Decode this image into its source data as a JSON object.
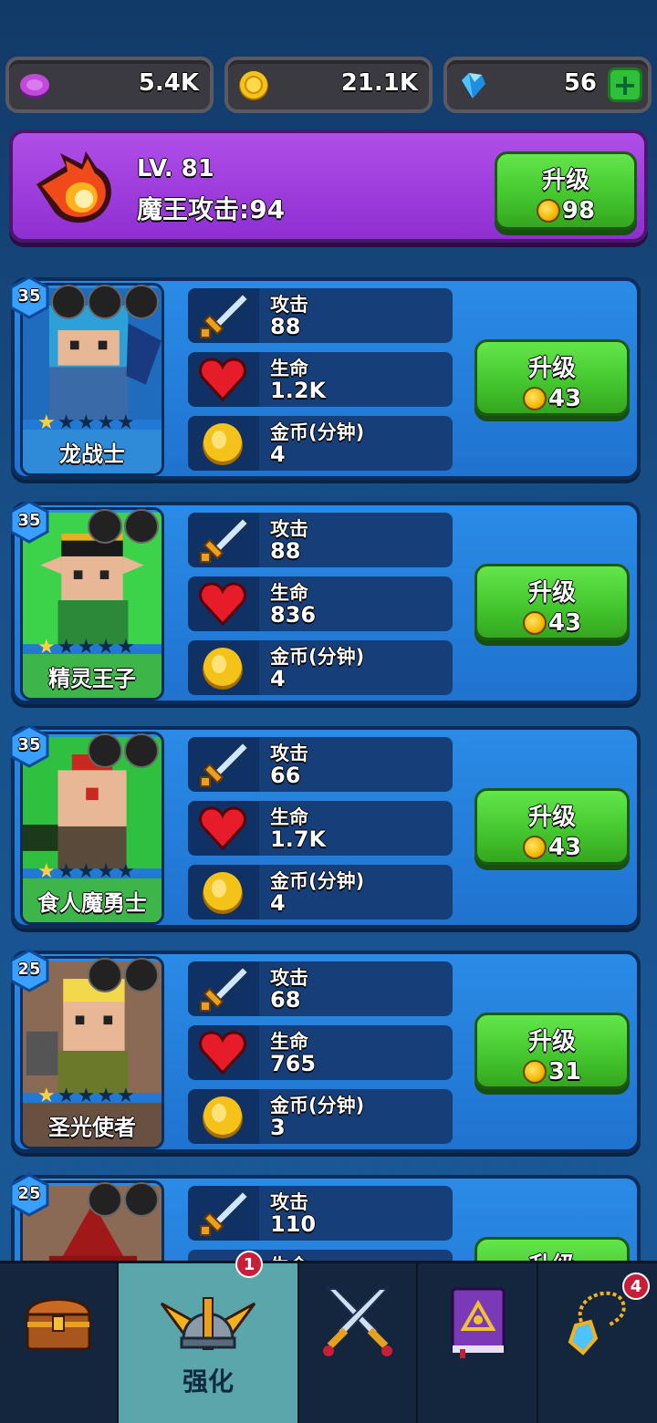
{
  "currencies": {
    "purple": {
      "value": "5.4K",
      "icon": "purple-gem-icon"
    },
    "gold": {
      "value": "21.1K",
      "icon": "gold-coin-icon"
    },
    "diamond": {
      "value": "56",
      "icon": "diamond-icon",
      "plus": "+"
    }
  },
  "boss": {
    "level": "LV. 81",
    "attack": "魔王攻击:94",
    "upgrade_label": "升级",
    "upgrade_cost": "98"
  },
  "stat_labels": {
    "attack": "攻击",
    "life": "生命",
    "gold": "金币(分钟)"
  },
  "heroes": [
    {
      "name": "龙战士",
      "level": "35",
      "stars": 1,
      "attack": "88",
      "life": "1.2K",
      "gold": "4",
      "upgrade_label": "升级",
      "cost": "43",
      "name_bg": "#2f8bd8",
      "art": "#2a78c8"
    },
    {
      "name": "精灵王子",
      "level": "35",
      "stars": 1,
      "attack": "88",
      "life": "836",
      "gold": "4",
      "upgrade_label": "升级",
      "cost": "43",
      "name_bg": "#3db548",
      "art": "#34c43e"
    },
    {
      "name": "食人魔勇士",
      "level": "35",
      "stars": 1,
      "attack": "66",
      "life": "1.7K",
      "gold": "4",
      "upgrade_label": "升级",
      "cost": "43",
      "name_bg": "#3db548",
      "art": "#2fc040"
    },
    {
      "name": "圣光使者",
      "level": "25",
      "stars": 1,
      "attack": "68",
      "life": "765",
      "gold": "3",
      "upgrade_label": "升级",
      "cost": "31",
      "name_bg": "#6a5040",
      "art": "#8a6a54"
    },
    {
      "name": "",
      "level": "25",
      "stars": 0,
      "attack": "110",
      "life": "生命",
      "gold": "",
      "upgrade_label": "升级",
      "cost": "",
      "name_bg": "#7a5a48",
      "art": "#8a6a54"
    }
  ],
  "nav": {
    "items": [
      {
        "id": "chest",
        "icon": "treasure-chest-icon",
        "label": ""
      },
      {
        "id": "upgrade",
        "icon": "winged-helmet-icon",
        "label": "强化",
        "badge": "1"
      },
      {
        "id": "battle",
        "icon": "crossed-swords-icon",
        "label": ""
      },
      {
        "id": "book",
        "icon": "spell-book-icon",
        "label": ""
      },
      {
        "id": "amulet",
        "icon": "amulet-icon",
        "label": "",
        "badge": "4"
      }
    ]
  }
}
